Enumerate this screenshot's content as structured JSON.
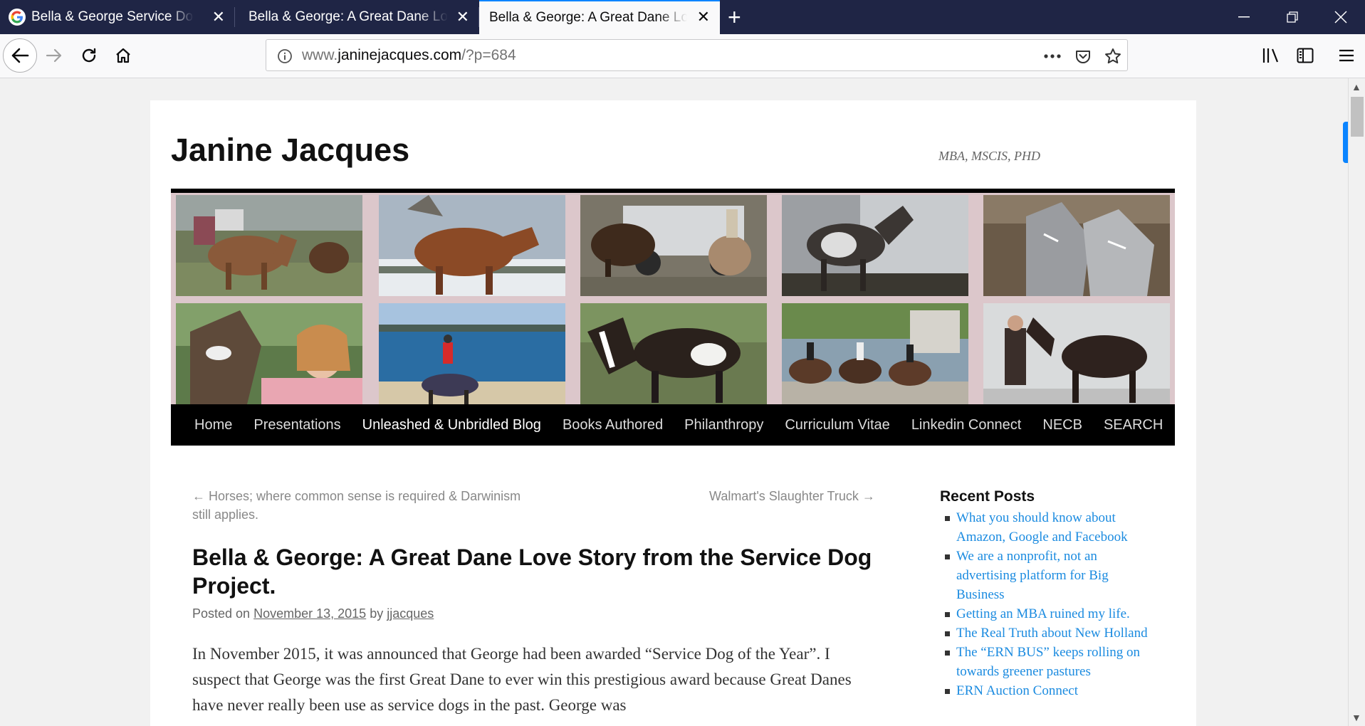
{
  "browser": {
    "tabs": [
      {
        "title": "Bella & George Service Dog Project",
        "active": false
      },
      {
        "title": "Bella & George: A Great Dane Love Story",
        "active": false
      },
      {
        "title": "Bella & George: A Great Dane Love Story",
        "active": true
      }
    ],
    "url": {
      "prefix": "www.",
      "domain": "janinejacques.com",
      "path": "/?p=684"
    },
    "accent": "#0a84ff"
  },
  "site": {
    "title": "Janine Jacques",
    "description": "MBA, MSCIS, PHD"
  },
  "menu": [
    {
      "label": "Home",
      "current": false
    },
    {
      "label": "Presentations",
      "current": false
    },
    {
      "label": "Unleashed & Unbridled Blog",
      "current": true
    },
    {
      "label": "Books Authored",
      "current": false
    },
    {
      "label": "Philanthropy",
      "current": false
    },
    {
      "label": "Curriculum Vitae",
      "current": false
    },
    {
      "label": "Linkedin Connect",
      "current": false
    },
    {
      "label": "NECB",
      "current": false
    },
    {
      "label": "SEARCH",
      "current": false
    }
  ],
  "post_nav": {
    "previous": "← Horses; where common sense is required & Darwinism still applies.",
    "next": "Walmart's Slaughter Truck →"
  },
  "post": {
    "title": "Bella & George: A Great Dane Love Story from the Service Dog Project.",
    "meta_prefix": "Posted on",
    "date": "November 13, 2015",
    "meta_by": "by",
    "author": "jjacques",
    "body": "In November 2015, it was announced that George had been awarded “Service Dog of the Year”.   I suspect that George was the first Great Dane to ever win this prestigious award because Great Danes have never really been use as service dogs in the past.  George was"
  },
  "sidebar": {
    "heading": "Recent Posts",
    "posts": [
      "What you should know about Amazon, Google and Facebook",
      "We are a nonprofit, not an advertising platform for Big Business",
      "Getting an MBA ruined my life.",
      "The Real Truth about New Holland",
      "The “ERN BUS” keeps rolling on towards greener pastures",
      "ERN Auction Connect"
    ]
  }
}
